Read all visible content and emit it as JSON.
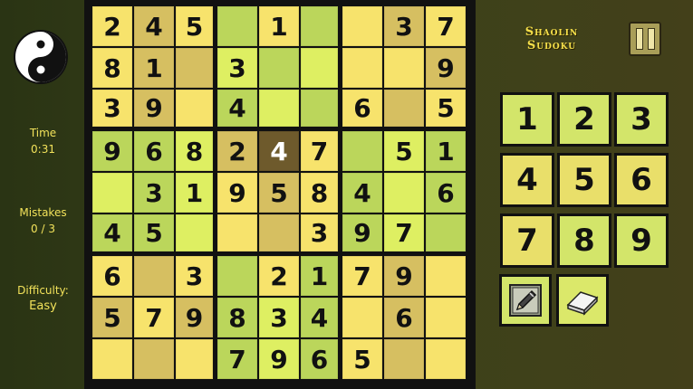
{
  "side": {
    "time_label": "Time",
    "time_value": "0:31",
    "mistakes_label": "Mistakes",
    "mistakes_value": "0 / 3",
    "difficulty_label": "Difficulty:",
    "difficulty_value": "Easy",
    "logo_icon": "yin-yang-icon"
  },
  "header": {
    "title_line1": "Shaolin",
    "title_line2": "Sudoku",
    "pause_icon": "pause-icon"
  },
  "board": {
    "selected": [
      3,
      4
    ],
    "rows": [
      [
        "2",
        "4",
        "5",
        "",
        "1",
        "",
        "",
        "3",
        "7"
      ],
      [
        "8",
        "1",
        "",
        "3",
        "",
        "",
        "",
        "",
        "9"
      ],
      [
        "3",
        "9",
        "",
        "4",
        "",
        "",
        "6",
        "",
        "5"
      ],
      [
        "9",
        "6",
        "8",
        "2",
        "4",
        "7",
        "",
        "5",
        "1"
      ],
      [
        "",
        "3",
        "1",
        "9",
        "5",
        "8",
        "4",
        "",
        "6"
      ],
      [
        "4",
        "5",
        "",
        "",
        "",
        "3",
        "9",
        "7",
        ""
      ],
      [
        "6",
        "",
        "3",
        "",
        "2",
        "1",
        "7",
        "9",
        ""
      ],
      [
        "5",
        "7",
        "9",
        "8",
        "3",
        "4",
        "",
        "6",
        ""
      ],
      [
        "",
        "",
        "",
        "7",
        "9",
        "6",
        "5",
        "",
        ""
      ]
    ],
    "colors": [
      [
        0,
        1,
        0,
        2,
        0,
        2,
        0,
        1,
        0
      ],
      [
        0,
        1,
        1,
        3,
        2,
        3,
        0,
        0,
        1
      ],
      [
        0,
        1,
        0,
        2,
        3,
        2,
        0,
        1,
        0
      ],
      [
        2,
        2,
        3,
        1,
        4,
        0,
        2,
        3,
        2
      ],
      [
        3,
        2,
        3,
        0,
        1,
        0,
        2,
        3,
        2
      ],
      [
        2,
        2,
        3,
        0,
        1,
        0,
        2,
        3,
        2
      ],
      [
        0,
        1,
        0,
        2,
        0,
        2,
        0,
        1,
        0
      ],
      [
        1,
        0,
        1,
        2,
        3,
        2,
        0,
        1,
        0
      ],
      [
        0,
        1,
        0,
        2,
        3,
        2,
        0,
        1,
        0
      ]
    ]
  },
  "keypad": {
    "keys": [
      "1",
      "2",
      "3",
      "4",
      "5",
      "6",
      "7",
      "8",
      "9"
    ],
    "pencil_icon": "pencil-icon",
    "eraser_icon": "eraser-icon"
  }
}
